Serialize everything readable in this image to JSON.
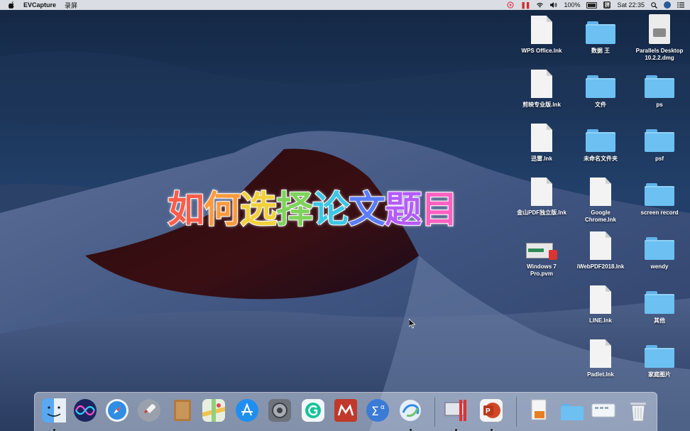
{
  "menubar": {
    "app_name": "EVCapture",
    "menu_record": "录屏",
    "battery_percent": "100%",
    "clock": "Sat 22:35",
    "input_source": "拼"
  },
  "overlay_title": [
    "如",
    "何",
    "选",
    "择",
    "论",
    "文",
    "题",
    "目"
  ],
  "overlay_colors": [
    "#ff5d4a",
    "#ff9a3c",
    "#f2d13a",
    "#7fd35d",
    "#3cc7e6",
    "#5a7cff",
    "#b45cff",
    "#ff60c0"
  ],
  "desktop_icons": [
    {
      "label": "WPS Office.lnk",
      "icon": "document-icon"
    },
    {
      "label": "数据 王",
      "icon": "folder-icon"
    },
    {
      "label": "Parallels Desktop\n10.2.2.dmg",
      "icon": "disk-image-icon"
    },
    {
      "label": "剪映专业版.lnk",
      "icon": "document-icon"
    },
    {
      "label": "文件",
      "icon": "folder-icon"
    },
    {
      "label": "ps",
      "icon": "folder-icon"
    },
    {
      "label": "迅雷.lnk",
      "icon": "document-icon"
    },
    {
      "label": "未命名文件夹",
      "icon": "folder-icon"
    },
    {
      "label": "psf",
      "icon": "folder-icon"
    },
    {
      "label": "金山PDF独立版.lnk",
      "icon": "document-icon"
    },
    {
      "label": "Google\nChrome.lnk",
      "icon": "document-icon"
    },
    {
      "label": "screen record",
      "icon": "folder-icon"
    },
    {
      "label": "Windows 7\nPro.pvm",
      "icon": "parallels-vm-icon"
    },
    {
      "label": "iWebPDF2018.lnk",
      "icon": "document-icon"
    },
    {
      "label": "wendy",
      "icon": "folder-icon"
    },
    {
      "label": "LINE.lnk",
      "icon": "document-icon"
    },
    {
      "label": "其他",
      "icon": "folder-icon"
    },
    {
      "label": "Padlet.lnk",
      "icon": "document-icon"
    },
    {
      "label": "家庭图片",
      "icon": "folder-icon"
    }
  ],
  "dock": [
    {
      "name": "finder-icon",
      "color": "#4a9cf0",
      "running": true
    },
    {
      "name": "siri-icon",
      "color": "#2b3a8f",
      "running": false
    },
    {
      "name": "safari-icon",
      "color": "#2f8de4",
      "running": false
    },
    {
      "name": "launchpad-icon",
      "color": "#c8ccd4",
      "running": false
    },
    {
      "name": "notebook-icon",
      "color": "#b27a3e",
      "running": false
    },
    {
      "name": "maps-icon",
      "color": "#7cc46a",
      "running": false
    },
    {
      "name": "app-store-icon",
      "color": "#1f8ef1",
      "running": false
    },
    {
      "name": "system-preferences-icon",
      "color": "#7a7f88",
      "running": false
    },
    {
      "name": "grammarly-icon",
      "color": "#e8ecef",
      "running": false
    },
    {
      "name": "mendeley-icon",
      "color": "#c0392b",
      "running": false
    },
    {
      "name": "mathtype-icon",
      "color": "#3a7bd5",
      "running": false
    },
    {
      "name": "sync-app-icon",
      "color": "#e6eef8",
      "running": true
    },
    {
      "name": "parallels-icon",
      "color": "#9aa4b1",
      "running": true
    },
    {
      "name": "powerpoint-icon",
      "color": "#d24726",
      "running": true
    },
    {
      "name": "document-stack-icon",
      "color": "#e8e8e8",
      "running": false
    },
    {
      "name": "folder-stack-icon",
      "color": "#6cc0f2",
      "running": false
    },
    {
      "name": "downloads-stack-icon",
      "color": "#eef2f6",
      "running": false
    },
    {
      "name": "trash-icon",
      "color": "#dfe3e8",
      "running": false
    }
  ]
}
